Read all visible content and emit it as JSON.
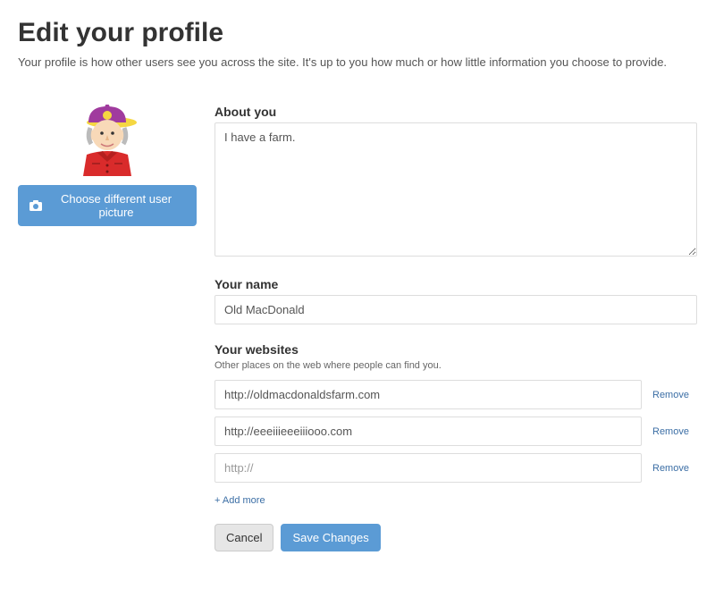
{
  "header": {
    "title": "Edit your profile",
    "subtitle": "Your profile is how other users see you across the site. It's up to you how much or how little information you choose to provide."
  },
  "avatar": {
    "choose_label": "Choose different user picture"
  },
  "about": {
    "label": "About you",
    "value": "I have a farm."
  },
  "name": {
    "label": "Your name",
    "value": "Old MacDonald"
  },
  "websites": {
    "label": "Your websites",
    "help": "Other places on the web where people can find you.",
    "placeholder": "http://",
    "remove_label": "Remove",
    "add_more_label": "+ Add more",
    "items": [
      {
        "value": "http://oldmacdonaldsfarm.com"
      },
      {
        "value": "http://eeeiiieeeiiiooo.com"
      },
      {
        "value": ""
      }
    ]
  },
  "actions": {
    "cancel": "Cancel",
    "save": "Save Changes"
  }
}
